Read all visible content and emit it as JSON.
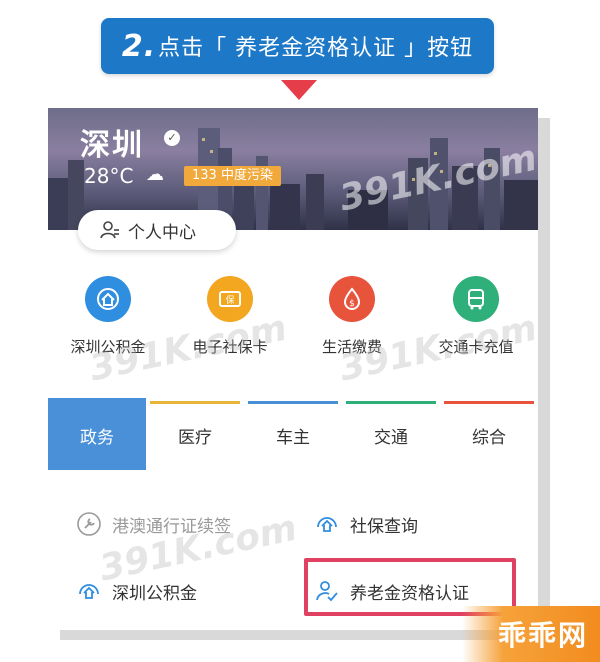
{
  "banner": {
    "step_number": "2.",
    "text": "点击「 养老金资格认证 」按钮"
  },
  "header": {
    "city": "深圳",
    "temperature": "28°C",
    "aqi": "133 中度污染",
    "personal_center": "个人中心"
  },
  "services": [
    {
      "label": "深圳公积金",
      "icon": "house-fund-icon",
      "color": "#2f8ee0"
    },
    {
      "label": "电子社保卡",
      "icon": "social-security-card-icon",
      "color": "#f3a61f"
    },
    {
      "label": "生活缴费",
      "icon": "payment-icon",
      "color": "#e8533b"
    },
    {
      "label": "交通卡充值",
      "icon": "transit-card-icon",
      "color": "#2fb07a"
    }
  ],
  "tabs": [
    {
      "label": "政务",
      "active": true,
      "color": "#4a90d9"
    },
    {
      "label": "医疗",
      "active": false,
      "color": "#e7b53b"
    },
    {
      "label": "车主",
      "active": false,
      "color": "#4a90d9"
    },
    {
      "label": "交通",
      "active": false,
      "color": "#2fb07a"
    },
    {
      "label": "综合",
      "active": false,
      "color": "#e8533b"
    }
  ],
  "functions": [
    {
      "label": "港澳通行证续签",
      "icon": "wrench-icon"
    },
    {
      "label": "社保查询",
      "icon": "shield-house-icon"
    },
    {
      "label": "深圳公积金",
      "icon": "house-fund-icon"
    },
    {
      "label": "养老金资格认证",
      "icon": "person-verify-icon"
    }
  ],
  "watermark": "391K.com",
  "corner_logo": "乖乖网"
}
